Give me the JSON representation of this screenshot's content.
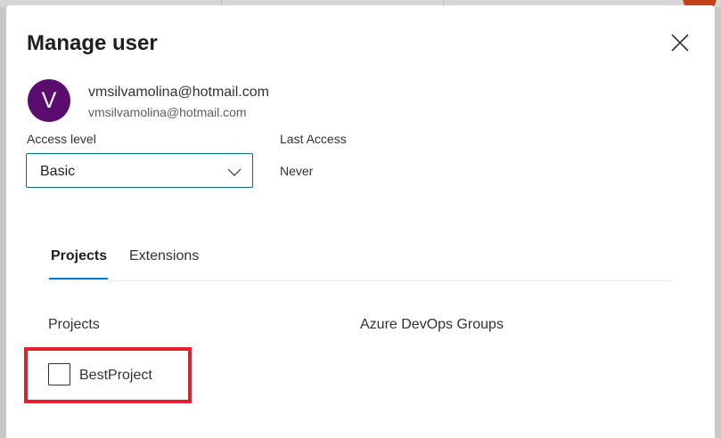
{
  "dialog": {
    "title": "Manage user",
    "close_icon": "close-icon"
  },
  "user": {
    "avatar_initial": "V",
    "name": "vmsilvamolina@hotmail.com",
    "email": "vmsilvamolina@hotmail.com",
    "avatar_color": "#5c0c6e"
  },
  "access": {
    "label": "Access level",
    "value": "Basic"
  },
  "last_access": {
    "label": "Last Access",
    "value": "Never"
  },
  "tabs": [
    {
      "label": "Projects",
      "selected": true
    },
    {
      "label": "Extensions",
      "selected": false
    }
  ],
  "sections": {
    "projects_heading": "Projects",
    "groups_heading": "Azure DevOps Groups"
  },
  "projects": [
    {
      "name": "BestProject",
      "checked": false
    }
  ],
  "colors": {
    "accent": "#0078d4",
    "highlight": "#e3202a",
    "dropdown_border": "#0b6a8a"
  }
}
